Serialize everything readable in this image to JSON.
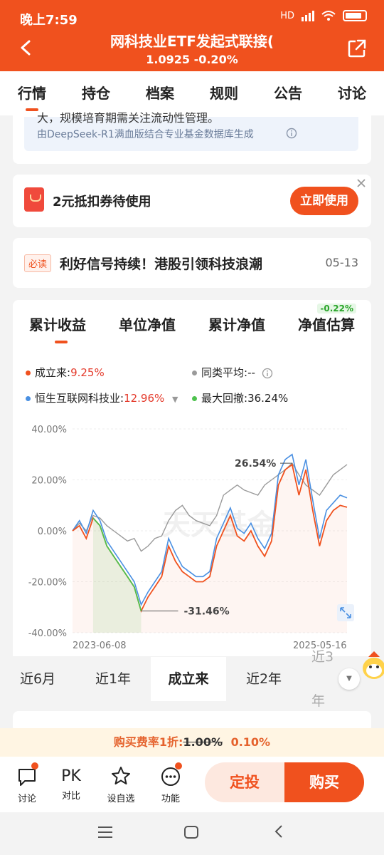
{
  "status": {
    "time": "晚上7:59",
    "network": "HD"
  },
  "header": {
    "title": "网科技业ETF发起式联接(",
    "subtitle": "1.0925 -0.20%"
  },
  "tabs": [
    "行情",
    "持仓",
    "档案",
    "规则",
    "公告",
    "讨论"
  ],
  "ai_note": {
    "partial_line": "大，规模培育期需关注流动性管理。",
    "source": "由DeepSeek-R1满血版结合专业基金数据库生成"
  },
  "coupon": {
    "text": "2元抵扣券待使用",
    "button": "立即使用"
  },
  "news": {
    "tag": "必读",
    "headline": "利好信号持续！港股引领科技浪潮",
    "date": "05-13"
  },
  "chart_tabs": {
    "items": [
      "累计收益",
      "单位净值",
      "累计净值",
      "净值估算"
    ],
    "badge": "-0.22%"
  },
  "legend": {
    "since_inception_label": "成立来:",
    "since_inception_value": "9.25%",
    "peer_avg_label": "同类平均:",
    "peer_avg_value": "--",
    "index_label": "恒生互联网科技业:",
    "index_value": "12.96%",
    "max_dd_label": "最大回撤:",
    "max_dd_value": "36.24%"
  },
  "colors": {
    "fund": "#f0511e",
    "index": "#4a90e2",
    "peer": "#9a9a9a",
    "drawdown": "#4fc24f"
  },
  "chart_data": {
    "type": "line",
    "x_labels": [
      "2023-06-08",
      "2025-05-16"
    ],
    "ylim": [
      -40,
      40
    ],
    "y_ticks": [
      "40.00%",
      "20.00%",
      "0.00%",
      "-20.00%",
      "-40.00%"
    ],
    "annotations": [
      "26.54%",
      "-31.46%"
    ],
    "watermark": "天天基金",
    "series": [
      {
        "values": [
          0,
          2,
          -3,
          5,
          2,
          -6,
          -10,
          -14,
          -18,
          -22,
          -31.46,
          -26,
          -22,
          -18,
          -6,
          -12,
          -16,
          -18,
          -20,
          -20,
          -18,
          -6,
          0,
          6,
          -2,
          -4,
          0,
          -6,
          -10,
          -4,
          18,
          24,
          26,
          14,
          24,
          8,
          -6,
          4,
          8,
          10,
          9.25
        ]
      },
      {
        "values": [
          0,
          4,
          -1,
          8,
          4,
          -4,
          -8,
          -12,
          -16,
          -20,
          -29,
          -24,
          -20,
          -16,
          -3,
          -9,
          -14,
          -16,
          -18,
          -18,
          -16,
          -3,
          3,
          9,
          1,
          -1,
          3,
          -3,
          -7,
          -1,
          22,
          28,
          30,
          18,
          28,
          12,
          -3,
          8,
          11,
          14,
          12.96
        ]
      },
      {
        "values": [
          0,
          3,
          0,
          6,
          5,
          2,
          0,
          -2,
          -4,
          -3,
          -8,
          -6,
          -3,
          -2,
          4,
          8,
          10,
          6,
          4,
          3,
          2,
          6,
          14,
          16,
          18,
          16,
          15,
          14,
          18,
          20,
          22,
          24,
          26.54,
          22,
          18,
          16,
          14,
          18,
          22,
          24,
          26
        ]
      }
    ]
  },
  "periods": [
    "近6月",
    "近1年",
    "成立来",
    "近2年",
    "近3年"
  ],
  "fee": {
    "label": "购买费率1折:",
    "original": "1.00%",
    "current": "0.10%"
  },
  "bottom_nav": {
    "discuss": "讨论",
    "pk_icon": "PK",
    "compare": "对比",
    "watchlist": "设自选",
    "function": "功能"
  },
  "actions": {
    "auto_invest": "定投",
    "buy": "购买"
  }
}
